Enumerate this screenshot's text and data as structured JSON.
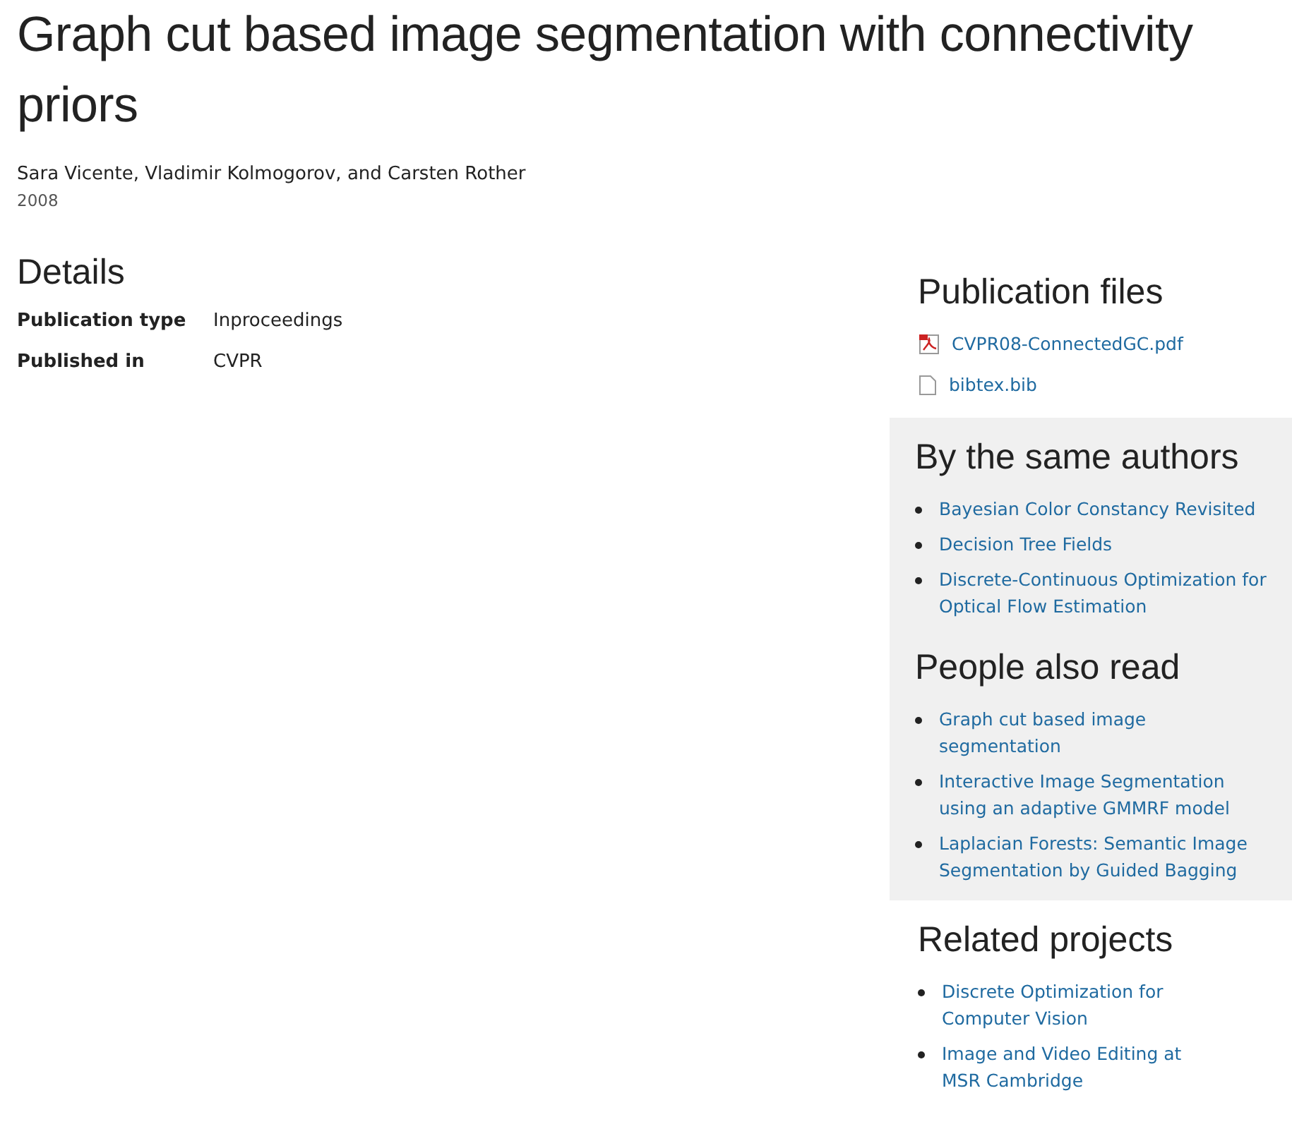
{
  "title": "Graph cut based image segmentation with connectivity priors",
  "authors": "Sara Vicente, Vladimir Kolmogorov, and Carsten Rother",
  "year": "2008",
  "details": {
    "heading": "Details",
    "rows": [
      {
        "label": "Publication type",
        "value": "Inproceedings"
      },
      {
        "label": "Published in",
        "value": "CVPR"
      }
    ]
  },
  "sidebar": [
    {
      "heading": "Publication files",
      "kind": "files",
      "shaded": false,
      "items": [
        {
          "label": "CVPR08-ConnectedGC.pdf",
          "kind": "pdf"
        },
        {
          "label": "bibtex.bib",
          "kind": "file"
        }
      ]
    },
    {
      "heading": "By the same authors",
      "kind": "links",
      "shaded": true,
      "items": [
        {
          "label": "Bayesian Color Constancy Revisited"
        },
        {
          "label": "Decision Tree Fields"
        },
        {
          "label": "Discrete-Continuous Optimization for Optical Flow Estimation"
        }
      ]
    },
    {
      "heading": "People also read",
      "kind": "links",
      "shaded": true,
      "items": [
        {
          "label": "Graph cut based image segmentation"
        },
        {
          "label": "Interactive Image Segmentation using an adaptive GMMRF model"
        },
        {
          "label": "Laplacian Forests: Semantic Image Segmentation by Guided Bagging"
        }
      ]
    },
    {
      "heading": "Related projects",
      "kind": "links",
      "shaded": false,
      "items": [
        {
          "label": "Discrete Optimization for Computer Vision"
        },
        {
          "label": "Image and Video Editing at MSR Cambridge"
        }
      ]
    }
  ]
}
